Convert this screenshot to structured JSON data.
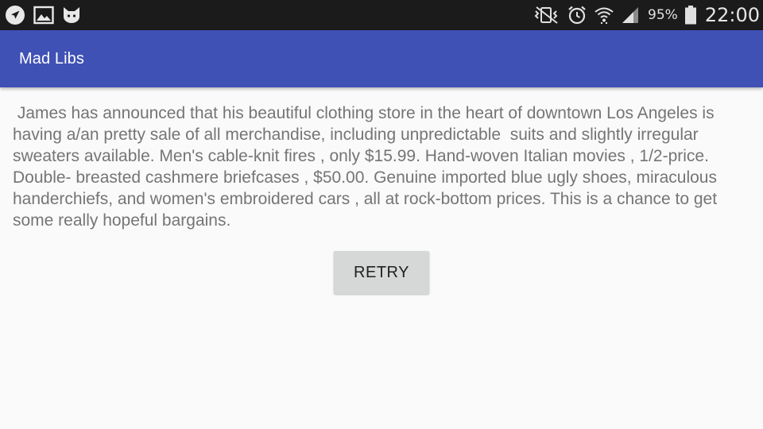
{
  "status_bar": {
    "left_icons": [
      "navigation-icon",
      "image-icon",
      "cat-icon"
    ],
    "right_icons": [
      "vibrate-icon",
      "alarm-icon",
      "wifi-icon",
      "signal-icon",
      "battery-icon"
    ],
    "battery_percent": "95%",
    "battery_level": 0.95,
    "time": "22:00"
  },
  "app_bar": {
    "title": "Mad Libs",
    "color": "#3f51b5"
  },
  "story": {
    "text": " James has announced that his beautiful clothing store in the heart of downtown Los Angeles is having a/an pretty sale of all merchandise, including unpredictable  suits and slightly irregular sweaters available. Men's cable-knit fires , only $15.99. Hand-woven Italian movies , 1/2-price. Double- breasted cashmere briefcases , $50.00. Genuine imported blue ugly shoes, miraculous  handerchiefs, and women's embroidered cars , all at rock-bottom prices. This is a chance to get some really hopeful bargains."
  },
  "retry_button": {
    "label": "RETRY"
  }
}
